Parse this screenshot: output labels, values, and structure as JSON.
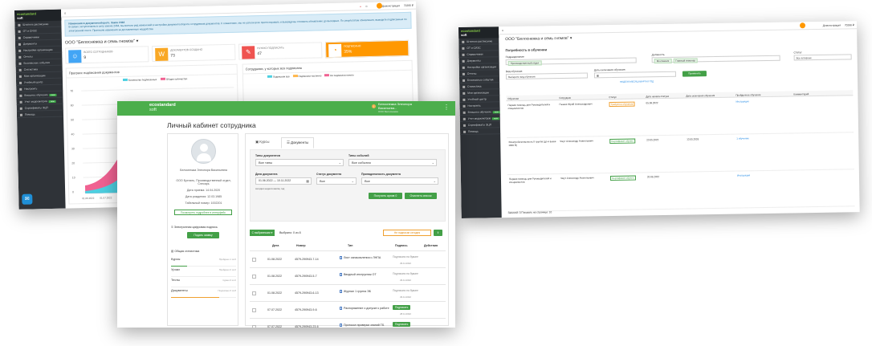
{
  "left_window": {
    "logo_line1": "ecostandard",
    "logo_line2": "soft",
    "sidebar": [
      {
        "label": "Штатное расписание"
      },
      {
        "label": "ОТ и СИЗС"
      },
      {
        "label": "Справочники"
      },
      {
        "label": "Документы"
      },
      {
        "label": "Настройки организации"
      },
      {
        "label": "Отчеты"
      },
      {
        "label": "Безопасные события"
      },
      {
        "label": "Статистика"
      },
      {
        "label": "Мои организации"
      },
      {
        "label": "Учебный центр"
      },
      {
        "label": "Настроить"
      },
      {
        "label": "Внешнее обучение",
        "badge": "new"
      },
      {
        "label": "Учет медосмотров",
        "badge": "new"
      },
      {
        "label": "Сертификаты ЭЦП"
      },
      {
        "label": "Помощь"
      }
    ],
    "topbar_user": "Демонстрация",
    "topbar_code": "70266 ₽",
    "alert_title": "Изменения в документообороте. Закон 2464",
    "alert_text": "В связи с вступлением в силу закона 2464, мы внесли ряд изменений в настройки документооборота сотрудников документов. К сожалению, мы не успели всех протестировать и вынуждены отложить обновление до выходных. По результатам обновления, выводите подписанные по электронной почте. Приносим извинения за доставленные неудобства",
    "org_title": "ООО \"Белоснежка и семь гномов\"",
    "cards": [
      {
        "label": "ВСЕГО СОТРУДНИКОВ",
        "value": "9",
        "color": "#42a5f5",
        "icon": "people-icon"
      },
      {
        "label": "ДОКУМЕНТОВ СОЗДАНО",
        "value": "73",
        "color": "#f9a825",
        "icon": "word-doc-icon"
      },
      {
        "label": "НУЖНО ПОДПИСАТЬ",
        "value": "47",
        "color": "#ef5350",
        "icon": "edit-icon"
      },
      {
        "label": "ПОДПИСАНО",
        "value": "35%",
        "color": "#ff9800",
        "icon": "pie-icon"
      }
    ],
    "panel1_title": "Прогресс подписания документов",
    "panel1_legend": [
      "Количество подписанных",
      "Общее количество"
    ],
    "panel2_title": "Сотрудники, у которых все подписано",
    "panel2_legend": [
      "Подписали все",
      "Подписали частично",
      "Ни подписали ничего"
    ],
    "y_ticks": [
      "70",
      "60",
      "50",
      "40",
      "30",
      "20",
      "10",
      "0"
    ],
    "x_ticks": [
      "01.06.2022",
      "01.07.2022",
      "01.08.2022",
      "01.09.2022"
    ]
  },
  "right_window": {
    "org_title": "ООО \"Белоснежка и семь гномов\"",
    "section_title": "Потребность в обучении",
    "f_division": "Подразделение",
    "f_position": "Должность",
    "f_status": "Статус",
    "chip_div": "Производственный отдел",
    "chip_pos1": "Монтажник",
    "chip_pos2": "Главный инженер",
    "status_val": "Все активные",
    "f_training": "Вид обучения",
    "f_dates": "Даты окончания обучения",
    "training_val": "Выберите вид обучения",
    "btn_apply": "Применить",
    "links": "НЕДЕЛЯ МЕСЯЦ КВАРТАЛ ГОД",
    "headers": [
      "Обучение",
      "Сотрудник",
      "Статус",
      "Дата начала статуса",
      "Дата окончания обучения",
      "Пройденное обучение",
      "Комментарий"
    ],
    "rows": [
      {
        "course": "Первая помощь для Руководителей и специалистов",
        "emp": "Пышка Юрий Александрович",
        "status": "Требуется обучение",
        "start": "05.08.2022",
        "end": "",
        "passed": "Инструкция"
      },
      {
        "course": "Электробезопасность II группа (до и выше 1000 В)",
        "emp": "Чмут Александр Анатольевич",
        "status": "Сертификат обучен",
        "start": "23.05.2022",
        "end": "13.05.2026",
        "passed": "1 обучение"
      },
      {
        "course": "Первая помощь для Руководителей и специалистов",
        "emp": "Чмут Александр Анатольевич",
        "status": "Сертификат обучен",
        "start": "20.06.2022",
        "end": "",
        "passed": "Инструкция"
      }
    ],
    "footer": "Записей: 3   Показать на странице: 10"
  },
  "front_window": {
    "logo_line1": "ecostandard",
    "logo_line2": "soft",
    "user_line1": "Белоснежка Элеонора",
    "user_line2": "Васильева...",
    "user_line3": "ООО Белоснежка",
    "page_title": "Личный кабинет сотрудника",
    "name": "Белоснежка Элеонора Васильевна",
    "org": "ООО Бухталь, Производственный отдел, Слесарь",
    "hire": "Дата приема: 14.04.2020",
    "birth": "Дата рождения: 12.03.1985",
    "phone": "Табельный номер: 1002201",
    "profile_btn": "Посмотреть подробнее в интерфейс",
    "ecp_label": "Электронная цифровая подпись",
    "ecp_btn": "Подать заявку",
    "stats_title": "Общая статистика",
    "stats": [
      {
        "label": "Курсы",
        "value": "Пройдено 1 из 6"
      },
      {
        "label": "Уроки",
        "value": "Пройдено 0 из 0"
      },
      {
        "label": "Тесты",
        "value": "Сдано 0 из 0"
      },
      {
        "label": "Документы",
        "value": "Подписано 6 из 8"
      }
    ],
    "tabs": [
      "Курсы",
      "Документы"
    ],
    "f_doc_type": "Типы документов",
    "f_events": "Типы событий",
    "v_doc_type": "Все типы",
    "v_events": "Все события",
    "f_date": "Дата документа",
    "f_status": "Статус документа",
    "f_belong": "Принадлежность документа",
    "v_date": "01.06.2022 — 10.11.2022",
    "v_status": "Все",
    "v_belong": "Все",
    "quick": "сегодня  неделя  месяц  год",
    "btn_archive": "Получить архив 0",
    "btn_clear": "Очистить список",
    "selected_btn": "С выбранными",
    "selected_count": "Выбрано: 0 из 8",
    "btn_not_signed": "Не подписан сегодня",
    "cols": [
      "Дата",
      "Номер",
      "Тип",
      "Подпись",
      "Действия"
    ],
    "rows": [
      {
        "date": "01.08.2022",
        "num": "4579-290943-7-14",
        "type": "Лист ознакомления с ЛНПА",
        "sign": "Подписано на бумаге",
        "sign2": "29.11.2022"
      },
      {
        "date": "01.08.2022",
        "num": "4579-290943-5-7",
        "type": "Вводный инструктаж ОТ",
        "sign": "Подписано на бумаге",
        "sign2": "29.11.2022"
      },
      {
        "date": "01.08.2022",
        "num": "4579-290943-6-13",
        "type": "Журнал 1 группа ЭБ",
        "sign": "Подписано на бумаге",
        "sign2": "29.11.2022"
      },
      {
        "date": "07.07.2022",
        "num": "4579-290943-9-6",
        "type": "Распоряжение о допуске к работе",
        "sign": "Подписать",
        "sign2": "28.11.2022"
      },
      {
        "date": "07.07.2022",
        "num": "4579-290943-23-6",
        "type": "Протокол проверки знаний ТБ",
        "sign": "Подписать",
        "sign2": "28.11.2022"
      },
      {
        "date": "07.07.2022",
        "num": "4579-290943-24-6",
        "type": "Удостоверение проверки знаний ТБ",
        "sign": "Подписать",
        "sign2": "28.11.2022"
      }
    ]
  }
}
